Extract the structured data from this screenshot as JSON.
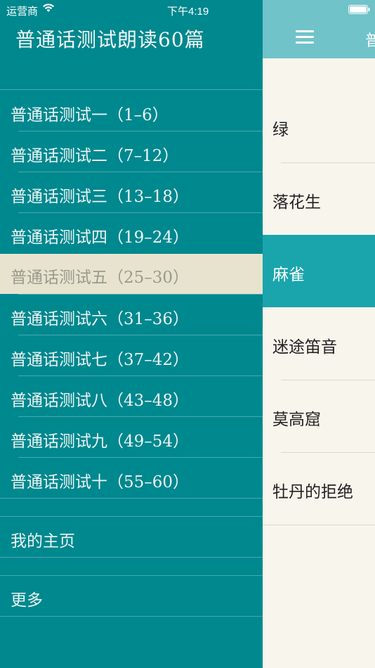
{
  "status_bar": {
    "carrier": "运营商",
    "time": "下午4:19"
  },
  "drawer": {
    "title": "普通话测试朗读60篇",
    "items": [
      {
        "label": "普通话测试一（1–6）",
        "selected": false
      },
      {
        "label": "普通话测试二（7–12）",
        "selected": false
      },
      {
        "label": "普通话测试三（13–18）",
        "selected": false
      },
      {
        "label": "普通话测试四（19–24）",
        "selected": false
      },
      {
        "label": "普通话测试五（25–30）",
        "selected": true
      },
      {
        "label": "普通话测试六（31–36）",
        "selected": false
      },
      {
        "label": "普通话测试七（37–42）",
        "selected": false
      },
      {
        "label": "普通话测试八（43–48）",
        "selected": false
      },
      {
        "label": "普通话测试九（49–54）",
        "selected": false
      },
      {
        "label": "普通话测试十（55–60）",
        "selected": false
      }
    ],
    "extra": [
      {
        "label": "我的主页"
      },
      {
        "label": "更多"
      }
    ]
  },
  "main": {
    "nav_title": "普",
    "articles": [
      {
        "title": "绿",
        "active": false
      },
      {
        "title": "落花生",
        "active": false
      },
      {
        "title": "麻雀",
        "active": true
      },
      {
        "title": "迷途笛音",
        "active": false
      },
      {
        "title": "莫高窟",
        "active": false
      },
      {
        "title": "牡丹的拒绝",
        "active": false
      }
    ]
  },
  "colors": {
    "drawer_bg": "#00888f",
    "selected_bg": "#e7e3cf",
    "navbar_bg": "#6fc3c9",
    "active_row_bg": "#1aa5ac",
    "content_bg": "#f8f5ec"
  },
  "icons": {
    "wifi": "wifi-icon",
    "battery": "battery-icon",
    "menu": "hamburger-menu-icon"
  }
}
